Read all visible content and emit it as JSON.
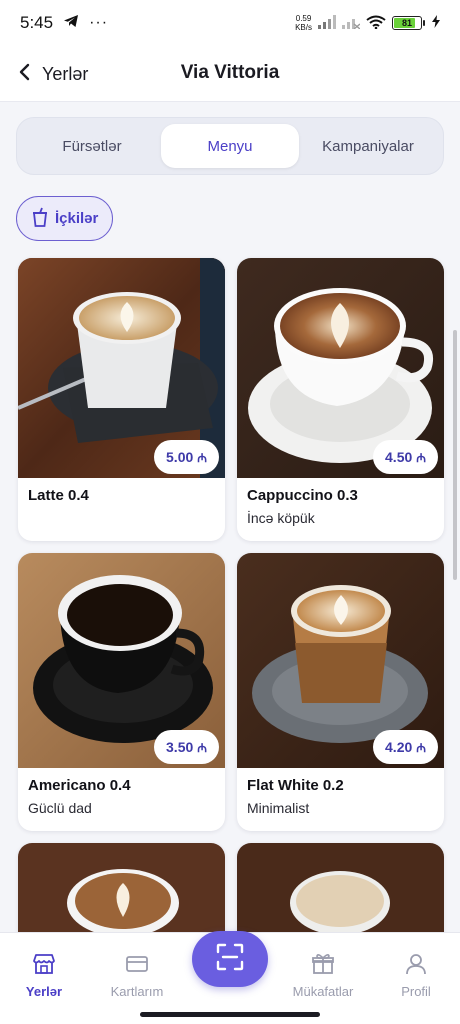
{
  "status_bar": {
    "time": "5:45",
    "speed_value": "0.59",
    "speed_unit": "KB/s",
    "battery_level": "81"
  },
  "header": {
    "back_label": "Yerlər",
    "title": "Via Vittoria"
  },
  "tabs": [
    {
      "label": "Fürsətlər",
      "active": false
    },
    {
      "label": "Menyu",
      "active": true
    },
    {
      "label": "Kampaniyalar",
      "active": false
    }
  ],
  "category_chip": {
    "label": "İçkilər",
    "icon": "drink-cup-icon"
  },
  "currency_symbol": "₼",
  "products": [
    {
      "name": "Latte 0.4",
      "description": "",
      "price": "5.00"
    },
    {
      "name": "Cappuccino 0.3",
      "description": "İncə köpük",
      "price": "4.50"
    },
    {
      "name": "Americano 0.4",
      "description": "Güclü dad",
      "price": "3.50"
    },
    {
      "name": "Flat White 0.2",
      "description": "Minimalist",
      "price": "4.20"
    }
  ],
  "bottom_nav": {
    "items": [
      {
        "label": "Yerlər",
        "icon": "store-icon",
        "active": true
      },
      {
        "label": "Kartlarım",
        "icon": "card-icon",
        "active": false
      },
      {
        "label": "",
        "icon": "scan-icon",
        "active": false
      },
      {
        "label": "Mükafatlar",
        "icon": "gift-icon",
        "active": false
      },
      {
        "label": "Profil",
        "icon": "user-icon",
        "active": false
      }
    ]
  },
  "colors": {
    "accent": "#4b3fc7",
    "scan_button": "#6a5ee0",
    "background": "#f4f5f9",
    "battery": "#6ad13a"
  }
}
